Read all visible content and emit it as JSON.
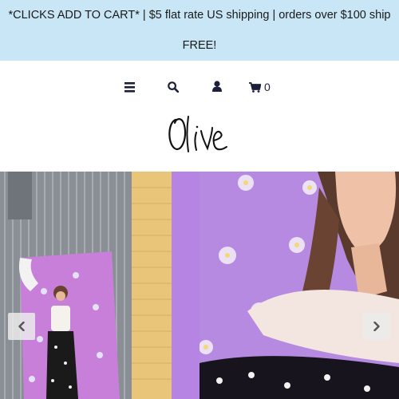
{
  "announcement": {
    "text": "*CLICKS ADD TO CART* | $5 flat rate US shipping | orders over $100 ship FREE!"
  },
  "nav": {
    "icons": [
      "menu-icon",
      "search-icon",
      "account-icon",
      "cart-icon"
    ],
    "cart_count": "0"
  },
  "logo": {
    "text": "Olive"
  },
  "slideshow": {
    "prev_icon": "chevron-left-icon",
    "next_icon": "chevron-right-icon"
  },
  "colors": {
    "announcement_bg": "#c9e6f6",
    "nav_icon": "#1b1f3a",
    "hero_purple": "#b58ae0"
  }
}
